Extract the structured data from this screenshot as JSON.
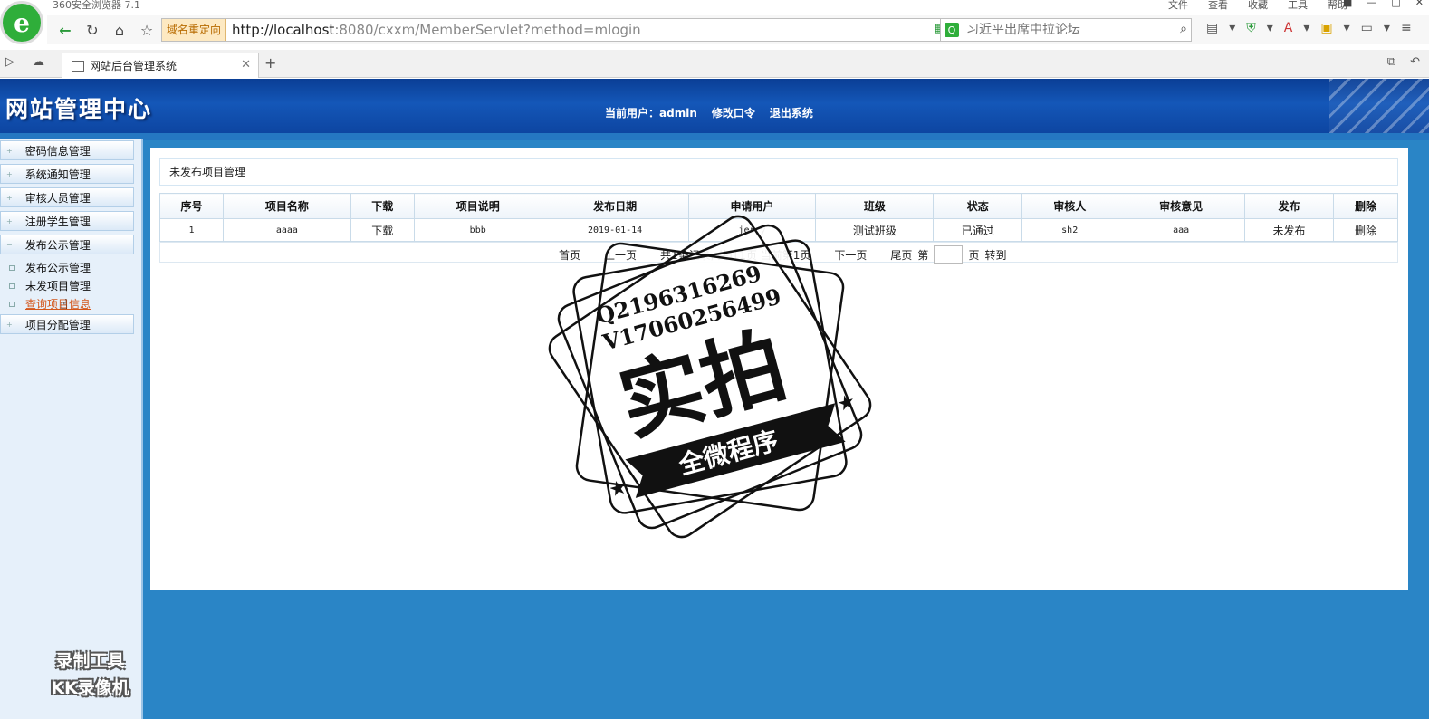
{
  "browser": {
    "app_title": "360安全浏览器 7.1",
    "menu": [
      "文件",
      "查看",
      "收藏",
      "工具",
      "帮助"
    ],
    "address_tag": "域名重定向",
    "url_host": "http://localhost",
    "url_rest": ":8080/cxxm/MemberServlet?method=mlogin",
    "search_placeholder": "习近平出席中拉论坛",
    "tab_title": "网站后台管理系统"
  },
  "header": {
    "site_title": "网站管理中心",
    "current_user_label": "当前用户：",
    "current_user": "admin",
    "change_password": "修改口令",
    "logout": "退出系统"
  },
  "sidebar": {
    "groups": [
      {
        "label": "密码信息管理"
      },
      {
        "label": "系统通知管理"
      },
      {
        "label": "审核人员管理"
      },
      {
        "label": "注册学生管理"
      },
      {
        "label": "发布公示管理"
      },
      {
        "label": "项目分配管理"
      }
    ],
    "sub_items": [
      {
        "label": "发布公示管理"
      },
      {
        "label": "未发项目管理"
      },
      {
        "label": "查询项目信息"
      }
    ]
  },
  "main": {
    "breadcrumb": "未发布项目管理",
    "columns": [
      "序号",
      "项目名称",
      "下载",
      "项目说明",
      "发布日期",
      "申请用户",
      "班级",
      "状态",
      "审核人",
      "审核意见",
      "发布",
      "删除"
    ],
    "rows": [
      {
        "no": "1",
        "name": "aaaa",
        "download": "下载",
        "desc": "bbb",
        "date": "2019-01-14",
        "user": "jerry",
        "class": "测试班级",
        "status": "已通过",
        "reviewer": "sh2",
        "opinion": "aaa",
        "publish": "未发布",
        "delete": "删除"
      }
    ],
    "pager": {
      "first": "首页",
      "prev": "上一页",
      "summary": "共1条记录, 共计1页 当前第1页",
      "next": "下一页",
      "last": "尾页",
      "page_prefix": "第",
      "page_suffix": "页",
      "goto": "转到"
    }
  },
  "watermark": {
    "line1": "Q2196316269",
    "line2": "V17060256499",
    "big": "实拍",
    "banner": "全微程序"
  },
  "recorder": {
    "line1": "录制工具",
    "line2": "KK录像机"
  }
}
